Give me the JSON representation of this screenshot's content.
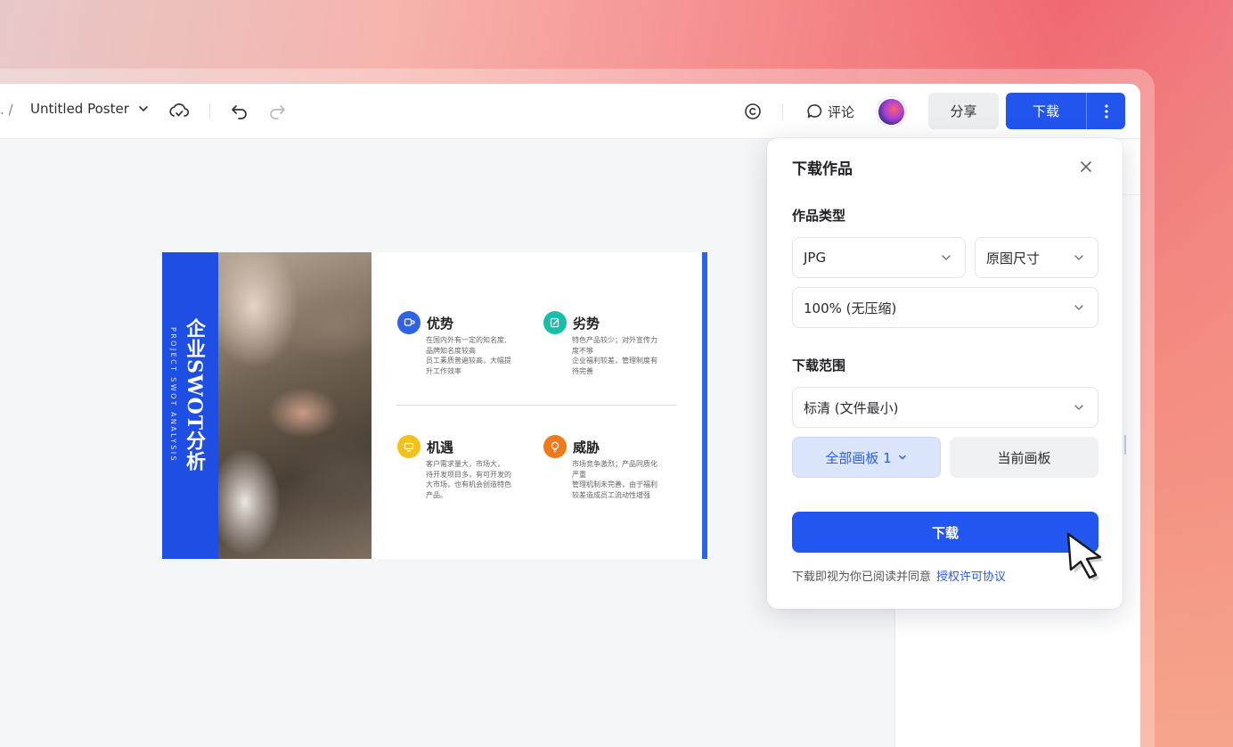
{
  "toolbar": {
    "breadcrumb_sep": ". /",
    "doc_title": "Untitled Poster",
    "comment_label": "评论",
    "share_label": "分享",
    "download_label": "下载"
  },
  "poster": {
    "title": "企业SWOT分析",
    "subtitle": "PROJECT SWOT ANALYSIS",
    "quadrants": [
      {
        "title": "优势",
        "desc": "在国内外有一定的知名度,\n品牌知名度较高\n员工素质普遍较高，大幅提\n升工作效率",
        "color": "#2f63e0",
        "icon": "cup-icon"
      },
      {
        "title": "劣势",
        "desc": "特色产品较少；对外宣传力\n度不够\n企业福利较差，管理制度有\n待完善",
        "color": "#17bfa8",
        "icon": "edit-icon"
      },
      {
        "title": "机遇",
        "desc": "客户需求量大，市场大，\n待开发项目多，有可开发的\n大市场，也有机会创造特色\n产品。",
        "color": "#f2c21b",
        "icon": "screen-icon"
      },
      {
        "title": "威胁",
        "desc": "市场竞争激烈；产品同质化\n严重\n管理机制未完善，由于福利\n较差造成员工流动性增强",
        "color": "#f07a1a",
        "icon": "bulb-icon"
      }
    ]
  },
  "popover": {
    "title": "下载作品",
    "type_label": "作品类型",
    "format_value": "JPG",
    "size_value": "原图尺寸",
    "quality_value": "100% (无压缩)",
    "range_label": "下载范围",
    "resolution_value": "标清 (文件最小)",
    "all_pages_label": "全部画板 1",
    "current_page_label": "当前画板",
    "download_button": "下载",
    "terms_text": "下载即视为你已阅读并同意",
    "terms_link": "授权许可协议"
  },
  "colors": {
    "accent": "#2256f0",
    "poster_blue": "#1f4ee3"
  }
}
